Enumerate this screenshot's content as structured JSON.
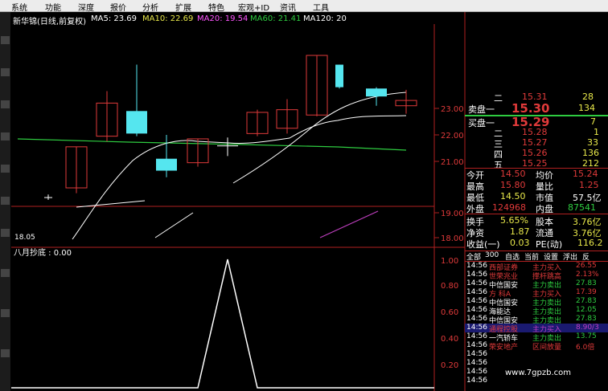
{
  "menu": [
    "系统",
    "功能",
    "深度",
    "报价",
    "分析",
    "扩展",
    "特色",
    "宏观+ID",
    "资讯",
    "工具"
  ],
  "chart_header": {
    "title": "新华锦(日线,前复权)",
    "ma5": "MA5: 23.69",
    "ma10": "MA10: 22.69",
    "ma20": "MA20: 19.54",
    "ma60": "MA60: 21.41",
    "ma120": "MA120: 20"
  },
  "price_axis": [
    "23.00",
    "22.00",
    "21.00",
    "19.00",
    "18.00"
  ],
  "low_marker": "18.05",
  "indicator": {
    "label": "八月抄底 : 0.00",
    "axis": [
      "1.00",
      "0.80",
      "0.60",
      "0.40",
      "0.20"
    ]
  },
  "chart_data": {
    "type": "candlestick",
    "title": "新华锦(日线,前复权)",
    "candles": [
      {
        "open": 19.65,
        "close": 19.65,
        "high": 19.75,
        "low": 19.55
      },
      {
        "open": 20.0,
        "close": 21.55,
        "high": 21.55,
        "low": 19.8
      },
      {
        "open": 21.95,
        "close": 23.2,
        "high": 23.65,
        "low": 21.75
      },
      {
        "open": 22.9,
        "close": 22.05,
        "high": 24.65,
        "low": 21.95
      },
      {
        "open": 21.1,
        "close": 20.65,
        "high": 22.0,
        "low": 20.4
      },
      {
        "open": 20.95,
        "close": 21.85,
        "high": 21.85,
        "low": 20.8
      },
      {
        "open": 21.6,
        "close": 21.6,
        "high": 21.9,
        "low": 21.2
      },
      {
        "open": 22.05,
        "close": 22.85,
        "high": 22.95,
        "low": 21.95
      },
      {
        "open": 22.25,
        "close": 22.95,
        "high": 23.35,
        "low": 22.05
      },
      {
        "open": 22.75,
        "close": 25.0,
        "high": 25.0,
        "low": 22.7
      },
      {
        "open": 24.65,
        "close": 23.8,
        "high": 24.65,
        "low": 23.75
      },
      {
        "open": 23.75,
        "close": 23.45,
        "high": 23.8,
        "low": 23.1
      },
      {
        "open": 23.1,
        "close": 23.3,
        "high": 23.7,
        "low": 22.8
      }
    ],
    "indicator_values": [
      0,
      0,
      0,
      0,
      0,
      0,
      1,
      0,
      0,
      0,
      0,
      0,
      0
    ]
  },
  "quote": {
    "sell": [
      [
        "二",
        "15.31",
        "28"
      ],
      [
        "卖盘一",
        "15.30",
        "134"
      ]
    ],
    "buy": [
      [
        "买盘一",
        "15.29",
        "7"
      ],
      [
        "二",
        "15.28",
        "1"
      ],
      [
        "三",
        "15.27",
        "33"
      ],
      [
        "四",
        "15.26",
        "136"
      ],
      [
        "五",
        "15.25",
        "212"
      ]
    ],
    "stats": [
      [
        "今开",
        "14.50",
        "均价",
        "15.24"
      ],
      [
        "最高",
        "15.80",
        "量比",
        "1.25"
      ],
      [
        "最低",
        "14.50",
        "市值",
        "57.5亿"
      ],
      [
        "外盘",
        "124968",
        "内盘",
        "87541"
      ],
      [
        "换手",
        "5.65%",
        "股本",
        "3.76亿"
      ],
      [
        "净资",
        "1.87",
        "流通",
        "3.76亿"
      ],
      [
        "收益(一)",
        "0.03",
        "PE(动)",
        "116.2"
      ]
    ]
  },
  "tabs": [
    "全部",
    "300",
    "自选",
    "当前",
    "设置",
    "浮出",
    "反"
  ],
  "ticks": [
    [
      "14:56",
      "西部证券",
      "主力买入",
      "26.55"
    ],
    [
      "14:56",
      "世荣兆业",
      "撑杆跳高",
      "2.13%"
    ],
    [
      "14:56",
      "中信国安",
      "主力卖出",
      "27.83"
    ],
    [
      "14:56",
      "方 科A",
      "主力买入",
      "17.39"
    ],
    [
      "14:56",
      "中信国安",
      "主力卖出",
      "27.83"
    ],
    [
      "14:56",
      "海能达",
      "主力卖出",
      "12.05"
    ],
    [
      "14:56",
      "中信国安",
      "主力卖出",
      "27.83"
    ],
    [
      "14:56",
      "通程控股",
      "主力买入",
      "8.90/3"
    ],
    [
      "14:56",
      "一汽轿车",
      "主力卖出",
      "13.75"
    ],
    [
      "14:56",
      "荣安地产",
      "区间放量",
      "6.0倍"
    ],
    [
      "14:56",
      "",
      "",
      ""
    ],
    [
      "14:56",
      "",
      "",
      ""
    ],
    [
      "14:56",
      "",
      "",
      ""
    ],
    [
      "14:56",
      "",
      "",
      ""
    ]
  ],
  "watermark": "www.7gpzb.com",
  "colors": {
    "up": "#e03a3a",
    "down": "#55e6ef",
    "ma5": "#ffffff",
    "ma60": "#2ecc40",
    "ma120": "#bf3fbf"
  }
}
